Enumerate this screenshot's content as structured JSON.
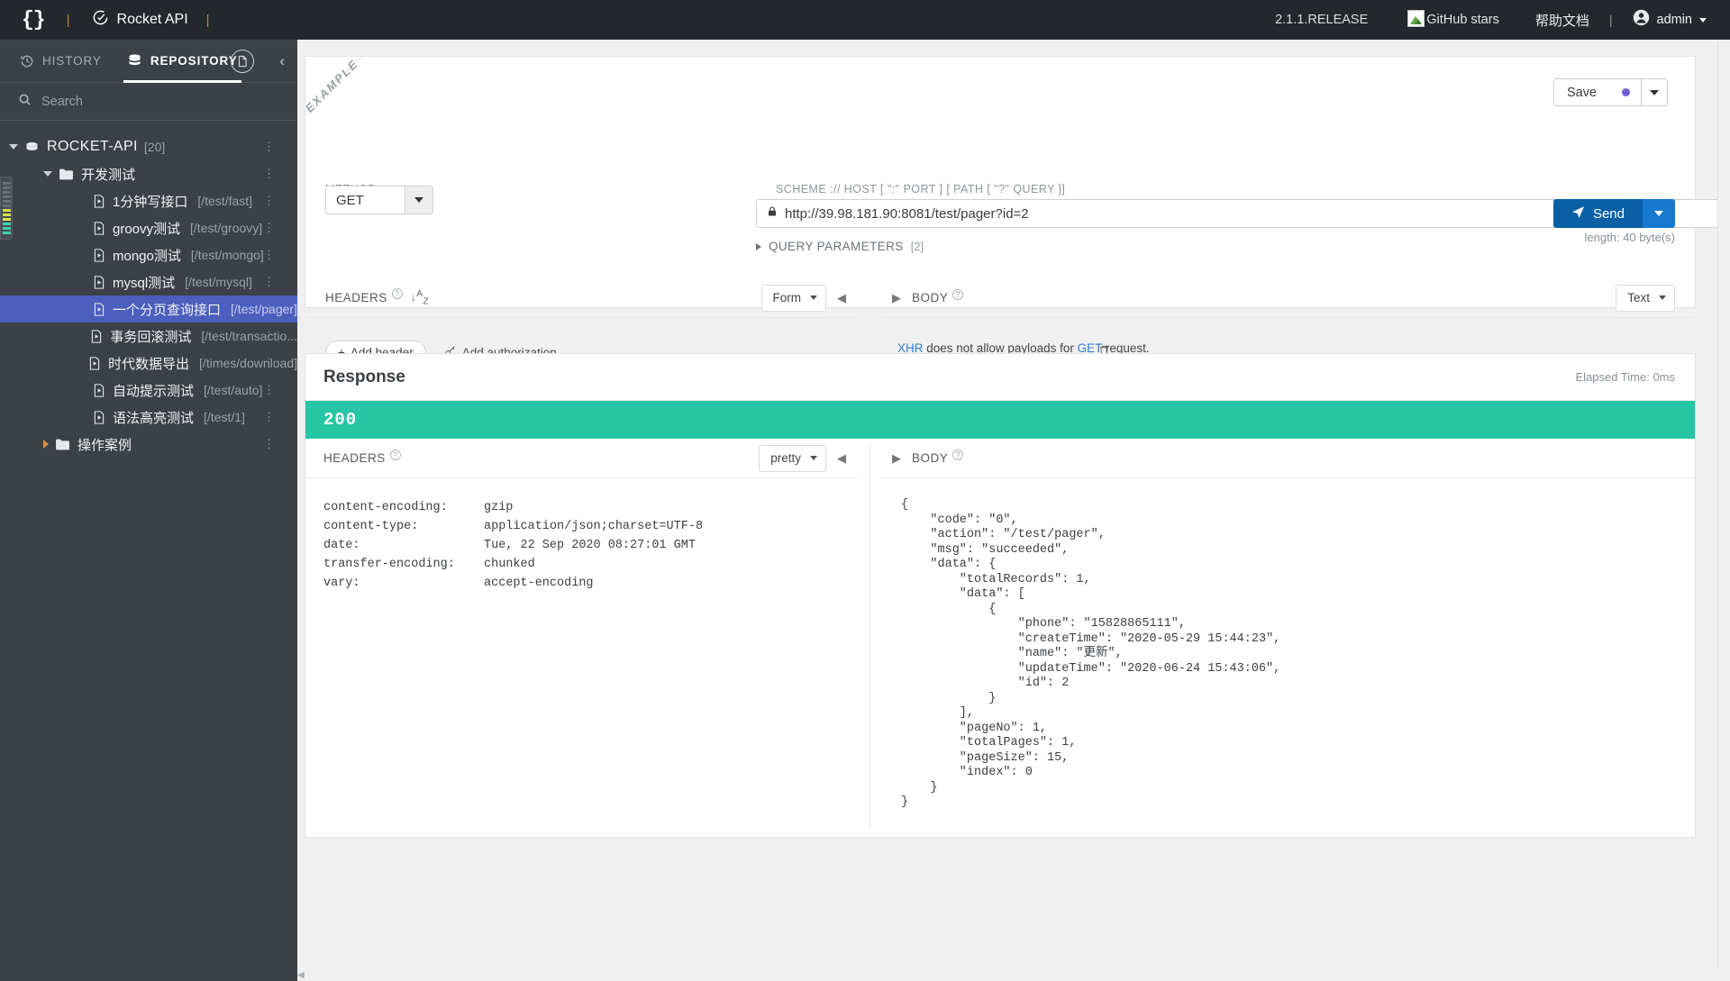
{
  "topbar": {
    "logo": "{}",
    "divider": "|",
    "brand": "Rocket API",
    "divider2": "|",
    "version": "2.1.1.RELEASE",
    "github_stars_alt": "GitHub stars",
    "help_doc": "帮助文档",
    "divider3": "|",
    "user": "admin"
  },
  "sidebar": {
    "tabs": [
      {
        "label": "HISTORY",
        "icon": "clock-icon",
        "active": false
      },
      {
        "label": "REPOSITORY",
        "icon": "database-icon",
        "active": true
      }
    ],
    "search_placeholder": "Search",
    "tree": [
      {
        "label": "ROCKET-API",
        "count": "[20]",
        "path": "",
        "indent": 10,
        "type": "root",
        "arrow": "expanded",
        "icon": "database-icon",
        "selected": false
      },
      {
        "label": "开发测试",
        "count": "",
        "path": "",
        "indent": 48,
        "type": "folder",
        "arrow": "expanded",
        "icon": "folder-icon",
        "selected": false
      },
      {
        "label": "1分钟写接口",
        "count": "",
        "path": "[/test/fast]",
        "indent": 86,
        "type": "api",
        "arrow": "none",
        "icon": "file-icon",
        "selected": false
      },
      {
        "label": "groovy测试",
        "count": "",
        "path": "[/test/groovy]",
        "indent": 86,
        "type": "api",
        "arrow": "none",
        "icon": "file-icon",
        "selected": false
      },
      {
        "label": "mongo测试",
        "count": "",
        "path": "[/test/mongo]",
        "indent": 86,
        "type": "api",
        "arrow": "none",
        "icon": "file-icon",
        "selected": false
      },
      {
        "label": "mysql测试",
        "count": "",
        "path": "[/test/mysql]",
        "indent": 86,
        "type": "api",
        "arrow": "none",
        "icon": "file-icon",
        "selected": false
      },
      {
        "label": "一个分页查询接口",
        "count": "",
        "path": "[/test/pager]",
        "indent": 86,
        "type": "api",
        "arrow": "none",
        "icon": "file-icon",
        "selected": true
      },
      {
        "label": "事务回滚测试",
        "count": "",
        "path": "[/test/transactio...",
        "indent": 86,
        "type": "api",
        "arrow": "none",
        "icon": "file-icon",
        "selected": false
      },
      {
        "label": "时代数据导出",
        "count": "",
        "path": "[/times/download]",
        "indent": 86,
        "type": "api",
        "arrow": "none",
        "icon": "file-icon",
        "selected": false
      },
      {
        "label": "自动提示测试",
        "count": "",
        "path": "[/test/auto]",
        "indent": 86,
        "type": "api",
        "arrow": "none",
        "icon": "file-icon",
        "selected": false
      },
      {
        "label": "语法高亮测试",
        "count": "",
        "path": "[/test/1]",
        "indent": 86,
        "type": "api",
        "arrow": "none",
        "icon": "file-icon",
        "selected": false
      },
      {
        "label": "操作案例",
        "count": "",
        "path": "",
        "indent": 48,
        "type": "folder",
        "arrow": "collapsed",
        "icon": "folder-icon",
        "selected": false
      }
    ]
  },
  "request": {
    "ribbon": "EXAMPLE",
    "save_label": "Save",
    "method_label": "METHOD",
    "method_value": "GET",
    "url_label": "SCHEME :// HOST [ \":\" PORT ] [ PATH [ \"?\" QUERY ]]",
    "url_value": "http://39.98.181.90:8081/test/pager?id=2",
    "send_label": "Send",
    "length_note": "length: 40 byte(s)",
    "query_params_label": "QUERY PARAMETERS",
    "query_params_count": "[2]",
    "headers_title": "HEADERS",
    "headers_format": "Form",
    "add_header": "Add header",
    "add_authorization": "Add authorization",
    "body_title": "BODY",
    "body_format": "Text",
    "body_note_prefix": "XHR",
    "body_note_mid": " does not allow payloads for ",
    "body_note_method": "GET",
    "body_note_suffix": " request."
  },
  "response": {
    "title": "Response",
    "elapsed": "Elapsed Time: 0ms",
    "status_code": "200",
    "status_color": "#26c6a5",
    "headers_title": "HEADERS",
    "headers_format": "pretty",
    "body_title": "BODY",
    "headers": [
      {
        "key": "content-encoding:",
        "value": "gzip"
      },
      {
        "key": "content-type:",
        "value": "application/json;charset=UTF-8"
      },
      {
        "key": "date:",
        "value": "Tue, 22 Sep 2020 08:27:01 GMT"
      },
      {
        "key": "transfer-encoding:",
        "value": "chunked"
      },
      {
        "key": "vary:",
        "value": "accept-encoding"
      }
    ],
    "body_json": "{\n    \"code\": \"0\",\n    \"action\": \"/test/pager\",\n    \"msg\": \"succeeded\",\n    \"data\": {\n        \"totalRecords\": 1,\n        \"data\": [\n            {\n                \"phone\": \"15828865111\",\n                \"createTime\": \"2020-05-29 15:44:23\",\n                \"name\": \"更新\",\n                \"updateTime\": \"2020-06-24 15:43:06\",\n                \"id\": 2\n            }\n        ],\n        \"pageNo\": 1,\n        \"totalPages\": 1,\n        \"pageSize\": 15,\n        \"index\": 0\n    }\n}"
  },
  "colors": {
    "topbar_bg": "#24282c",
    "sidebar_bg": "#3b4146",
    "selected_row": "#4c5fbd",
    "send_blue": "#0b5fa5",
    "status_green": "#26c6a5",
    "save_dot": "#6f5fd8"
  }
}
